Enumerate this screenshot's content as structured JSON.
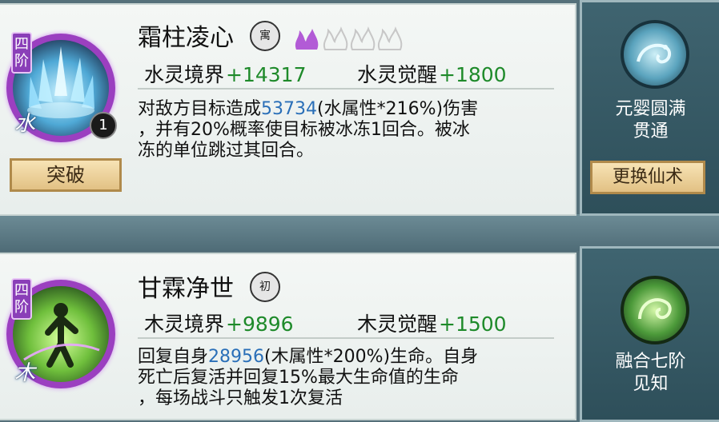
{
  "skills": [
    {
      "tier": "四阶",
      "element_char": "水",
      "count": "1",
      "name": "霜柱凌心",
      "rank_seal": "寓",
      "realm_label": "水灵境界",
      "realm_value": "+14317",
      "awaken_label": "水灵觉醒",
      "awaken_value": "+1800",
      "desc_pre": "对敌方目标造成",
      "desc_num": "53734",
      "desc_post_1": "(水属性*216%)伤害",
      "desc_line_2": "，并有20%概率使目标被冰冻1回合。被冰",
      "desc_line_3": "冻的单位跳过其回合。",
      "break_button": "突破",
      "side_text_1": "元婴圆满",
      "side_text_2": "贯通",
      "swap_button": "更换仙术"
    },
    {
      "tier": "四阶",
      "element_char": "木",
      "name": "甘霖净世",
      "rank_seal": "初",
      "realm_label": "木灵境界",
      "realm_value": "+9896",
      "awaken_label": "木灵觉醒",
      "awaken_value": "+1500",
      "desc_pre": "回复自身",
      "desc_num": "28956",
      "desc_post_1": "(木属性*200%)生命。自身",
      "desc_line_2": "死亡后复活并回复15%最大生命值的生命",
      "desc_line_3": "，每场战斗只触发1次复活",
      "side_text_1": "融合七阶",
      "side_text_2": "见知"
    }
  ],
  "colors": {
    "value_green": "#1e8a2a",
    "number_blue": "#2a6fb8",
    "tier_purple": "#8a3fb8"
  }
}
